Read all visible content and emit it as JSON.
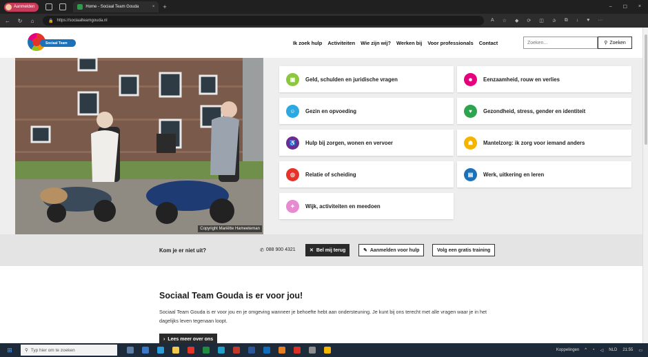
{
  "browser": {
    "profile_label": "Aanmelden",
    "tab_title": "Home - Sociaal Team Gouda",
    "tab_close": "×",
    "new_tab": "+",
    "url": "https://sociaalteamgouda.nl",
    "minimize": "–",
    "maximize": "☐",
    "close": "×"
  },
  "site": {
    "logo_text": "Sociaal Team",
    "nav": [
      "Ik zoek hulp",
      "Activiteiten",
      "Wie zijn wij?",
      "Werken bij",
      "Voor professionals",
      "Contact"
    ],
    "search_placeholder": "Zoeken...",
    "search_button": "Zoeken"
  },
  "hero": {
    "photo_credit": "Copyright Mariëtte Hameeteman"
  },
  "categories": [
    {
      "label": "Geld, schulden en juridische vragen",
      "color": "#8dc63f",
      "icon": "wallet-icon"
    },
    {
      "label": "Eenzaamheid, rouw en verlies",
      "color": "#e6007e",
      "icon": "heart-face-icon"
    },
    {
      "label": "Gezin en opvoeding",
      "color": "#2aaae1",
      "icon": "family-icon"
    },
    {
      "label": "Gezondheid, stress, gender en identiteit",
      "color": "#2ea44f",
      "icon": "heart-pulse-icon"
    },
    {
      "label": "Hulp bij zorgen, wonen en vervoer",
      "color": "#6a2c91",
      "icon": "wheelchair-icon"
    },
    {
      "label": "Mantelzorg: ik zorg voor iemand anders",
      "color": "#f4b400",
      "icon": "caregiver-icon"
    },
    {
      "label": "Relatie of scheiding",
      "color": "#e5332a",
      "icon": "rings-icon"
    },
    {
      "label": "Werk, uitkering en leren",
      "color": "#1d71b8",
      "icon": "briefcase-icon"
    },
    {
      "label": "Wijk, activiteiten en meedoen",
      "color": "#e78ad1",
      "icon": "running-icon"
    }
  ],
  "help_bar": {
    "question": "Kom je er niet uit?",
    "phone": "088 900 4321",
    "callback_button": "Bel mij terug",
    "register_button": "Aanmelden voor hulp",
    "training_button": "Volg een gratis training"
  },
  "intro": {
    "title": "Sociaal Team Gouda is er voor jou!",
    "body": "Sociaal Team Gouda is er voor jou en je omgeving wanneer je behoefte hebt aan ondersteuning. Je kunt bij ons terecht met alle vragen waar je in het dagelijks leven tegenaan loopt.",
    "more_button": "Lees meer over ons"
  },
  "taskbar": {
    "search_placeholder": "Typ hier om te zoeken",
    "links": "Koppelingen",
    "language": "NLD",
    "time": "21:55"
  }
}
